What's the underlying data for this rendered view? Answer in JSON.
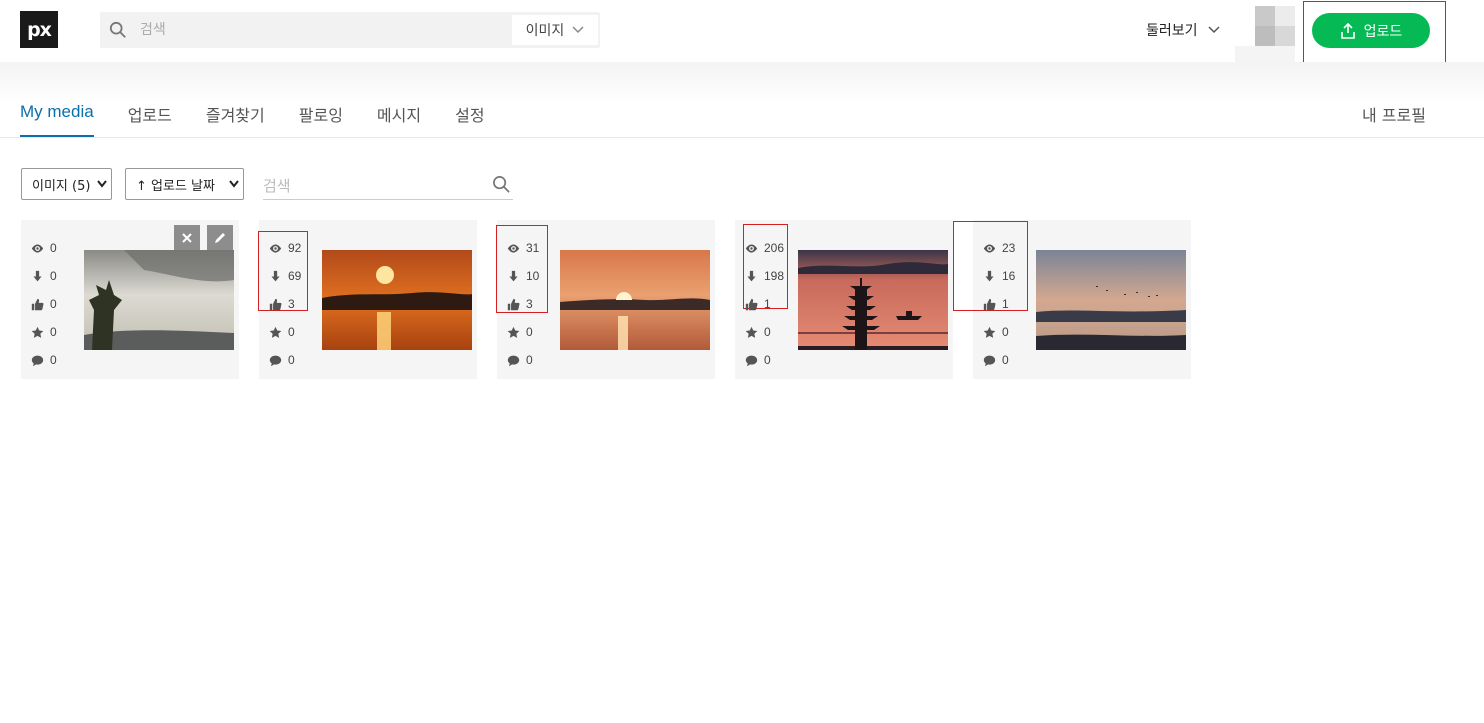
{
  "header": {
    "logo_text": "px",
    "search_placeholder": "검색",
    "search_type": "이미지",
    "explore_label": "둘러보기",
    "upload_label": "업로드"
  },
  "tabs": [
    {
      "label": "My media",
      "active": true
    },
    {
      "label": "업로드"
    },
    {
      "label": "즐겨찾기"
    },
    {
      "label": "팔로잉"
    },
    {
      "label": "메시지"
    },
    {
      "label": "설정"
    }
  ],
  "my_profile_label": "내 프로필",
  "filters": {
    "type_value": "이미지 (5)",
    "sort_value": "↑ 업로드 날짜",
    "search_placeholder": "검색"
  },
  "cards": [
    {
      "views": "0",
      "downloads": "0",
      "likes": "0",
      "favorites": "0",
      "comments": "0"
    },
    {
      "views": "92",
      "downloads": "69",
      "likes": "3",
      "favorites": "0",
      "comments": "0"
    },
    {
      "views": "31",
      "downloads": "10",
      "likes": "3",
      "favorites": "0",
      "comments": "0"
    },
    {
      "views": "206",
      "downloads": "198",
      "likes": "1",
      "favorites": "0",
      "comments": "0"
    },
    {
      "views": "23",
      "downloads": "16",
      "likes": "1",
      "favorites": "0",
      "comments": "0"
    }
  ],
  "colors": {
    "accent": "#0a6fae",
    "upload_green": "#05b955",
    "highlight_red": "#d42020"
  }
}
